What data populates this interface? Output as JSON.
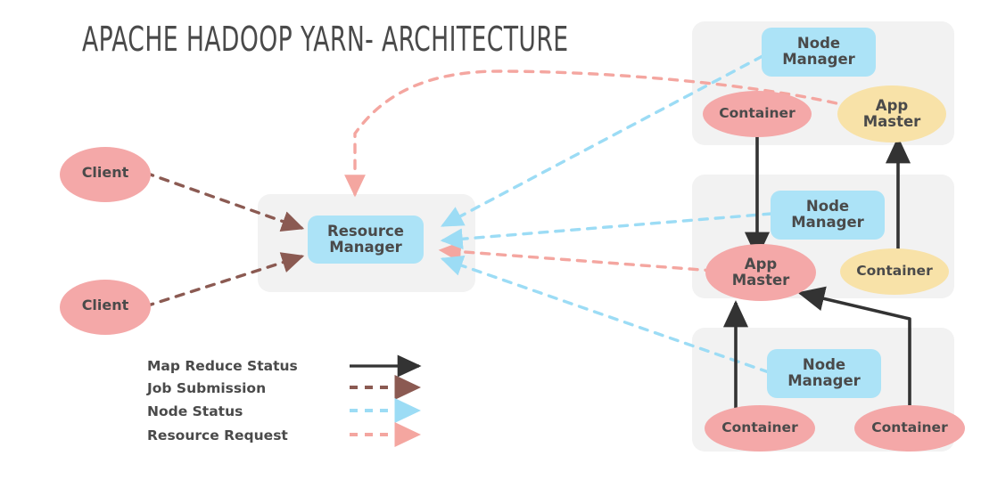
{
  "title": "APACHE HADOOP YARN- ARCHITECTURE",
  "colors": {
    "background": "#ffffff",
    "panel": "#f2f2f2",
    "pink": "#f4a8a8",
    "blue": "#ace3f7",
    "yellow": "#f8e2a8",
    "text": "#4a4a4a",
    "arrow_map_reduce_status": "#333333",
    "arrow_job_submission": "#8b5a52",
    "arrow_node_status": "#9cdcf5",
    "arrow_resource_request": "#f4a6a0"
  },
  "clients": [
    {
      "label": "Client"
    },
    {
      "label": "Client"
    }
  ],
  "resource_manager": {
    "label": "Resource\nManager"
  },
  "nodes": [
    {
      "name": "node-top",
      "node_manager": "Node\nManager",
      "items": [
        {
          "label": "Container",
          "color": "pink"
        },
        {
          "label": "App\nMaster",
          "color": "yellow"
        }
      ]
    },
    {
      "name": "node-middle",
      "node_manager": "Node\nManager",
      "items": [
        {
          "label": "App\nMaster",
          "color": "pink"
        },
        {
          "label": "Container",
          "color": "yellow"
        }
      ]
    },
    {
      "name": "node-bottom",
      "node_manager": "Node\nManager",
      "items": [
        {
          "label": "Container",
          "color": "pink"
        },
        {
          "label": "Container",
          "color": "pink"
        }
      ]
    }
  ],
  "legend": [
    {
      "label": "Map Reduce Status",
      "style": "solid",
      "color": "#333333"
    },
    {
      "label": "Job Submission",
      "style": "dashed",
      "color": "#8b5a52"
    },
    {
      "label": "Node Status",
      "style": "dashed",
      "color": "#9cdcf5"
    },
    {
      "label": "Resource Request",
      "style": "dashed",
      "color": "#f4a6a0"
    }
  ]
}
